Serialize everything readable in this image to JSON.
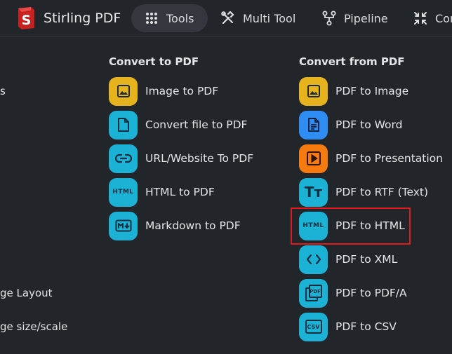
{
  "navbar": {
    "brand": "Stirling PDF",
    "tabs": [
      {
        "label": "Tools",
        "icon": "grid-icon",
        "active": true
      },
      {
        "label": "Multi Tool",
        "icon": "tools-icon",
        "active": false
      },
      {
        "label": "Pipeline",
        "icon": "pipeline-icon",
        "active": false
      },
      {
        "label": "Com",
        "icon": "compress-icon",
        "active": false
      }
    ]
  },
  "left_column": {
    "fragments": [
      "s",
      "",
      "ge Layout",
      "ge size/scale"
    ]
  },
  "convert_to_pdf": {
    "heading": "Convert to PDF",
    "items": [
      {
        "label": "Image to PDF",
        "icon": "image-icon",
        "color": "#e6b31e"
      },
      {
        "label": "Convert file to PDF",
        "icon": "file-icon",
        "color": "#1cb2d6"
      },
      {
        "label": "URL/Website To PDF",
        "icon": "link-icon",
        "color": "#1cb2d6"
      },
      {
        "label": "HTML to PDF",
        "icon": "html-icon",
        "icon_text": "HTML",
        "color": "#1cb2d6"
      },
      {
        "label": "Markdown to PDF",
        "icon": "markdown-icon",
        "color": "#1cb2d6"
      }
    ]
  },
  "convert_from_pdf": {
    "heading": "Convert from PDF",
    "items": [
      {
        "label": "PDF to Image",
        "icon": "image-icon",
        "color": "#e6b31e"
      },
      {
        "label": "PDF to Word",
        "icon": "document-icon",
        "color": "#2f8cf3"
      },
      {
        "label": "PDF to Presentation",
        "icon": "presentation-icon",
        "color": "#f57b11"
      },
      {
        "label": "PDF to RTF (Text)",
        "icon": "text-format-icon",
        "icon_text": "Tт",
        "color": "#1cb2d6"
      },
      {
        "label": "PDF to HTML",
        "icon": "html-icon",
        "icon_text": "HTML",
        "color": "#1cb2d6",
        "highlighted": true
      },
      {
        "label": "PDF to XML",
        "icon": "code-icon",
        "color": "#1cb2d6"
      },
      {
        "label": "PDF to PDF/A",
        "icon": "pdfa-icon",
        "icon_text": "PDF",
        "color": "#1cb2d6"
      },
      {
        "label": "PDF to CSV",
        "icon": "csv-icon",
        "icon_text": "CSV",
        "color": "#1cb2d6"
      }
    ]
  },
  "colors": {
    "background": "#222529",
    "active_tab": "#34383e",
    "highlight_border": "#e01b1b",
    "icon_glyph": "#0b2e40"
  }
}
